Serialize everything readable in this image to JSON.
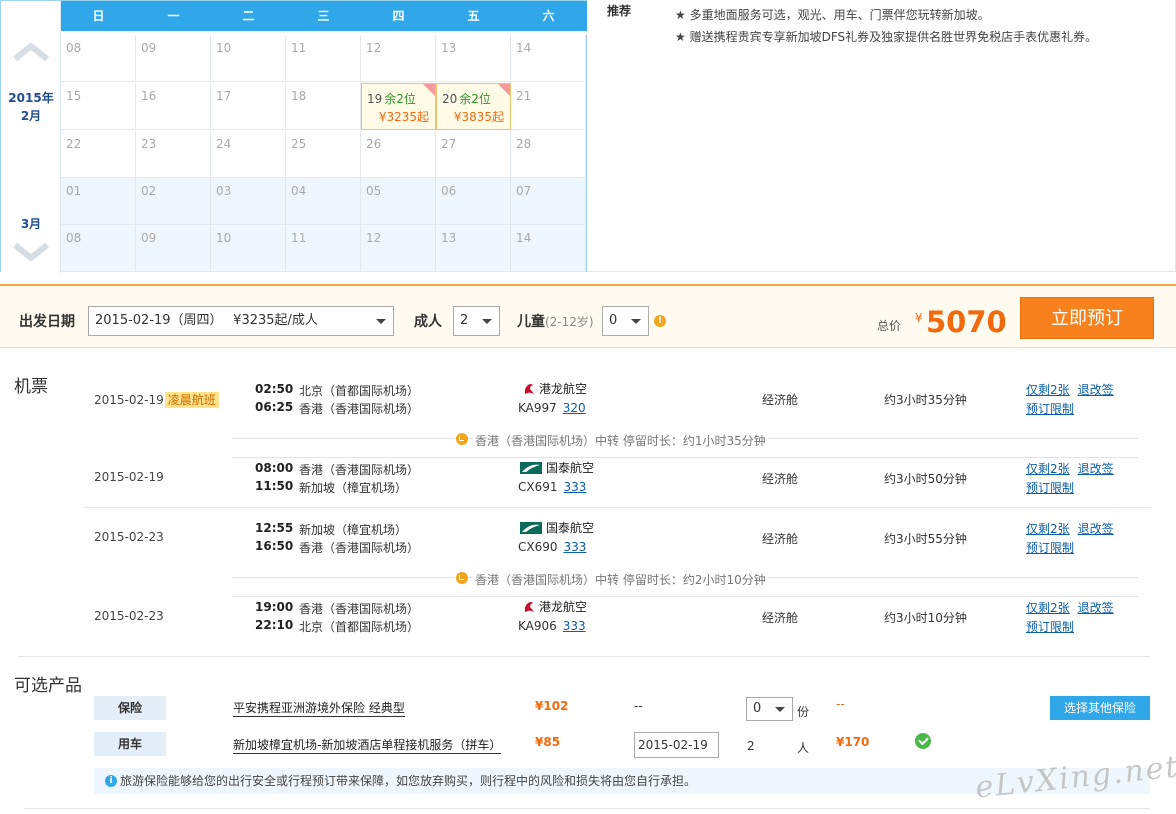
{
  "calendar": {
    "weekdays": [
      "日",
      "一",
      "二",
      "三",
      "四",
      "五",
      "六"
    ],
    "months": [
      {
        "label_year": "2015年",
        "label_month": "2月"
      },
      {
        "label_month": "3月"
      }
    ],
    "rows": [
      [
        "08",
        "09",
        "10",
        "11",
        "12",
        "13",
        "14"
      ],
      [
        "15",
        "16",
        "17",
        "18",
        "19",
        "20",
        "21"
      ],
      [
        "22",
        "23",
        "24",
        "25",
        "26",
        "27",
        "28"
      ],
      [
        "01",
        "02",
        "03",
        "04",
        "05",
        "06",
        "07"
      ],
      [
        "08",
        "09",
        "10",
        "11",
        "12",
        "13",
        "14"
      ]
    ],
    "highlights": [
      {
        "day": "19",
        "seats": "余2位",
        "price": "¥3235起"
      },
      {
        "day": "20",
        "seats": "余2位",
        "price": "¥3835起"
      }
    ]
  },
  "recommend": {
    "title": "推荐",
    "lines": [
      "★ 多重地面服务可选，观光、用车、门票伴您玩转新加坡。",
      "★ 赠送携程贵宾专享新加坡DFS礼券及独家提供名胜世界免税店手表优惠礼券。"
    ]
  },
  "order": {
    "date_label": "出发日期",
    "date_value": "2015-02-19（周四）　 ¥3235起/成人",
    "adult_label": "成人",
    "adult_value": "2",
    "child_label": "儿童",
    "child_age": "(2-12岁)",
    "child_value": "0",
    "total_label": "总价",
    "currency": "¥",
    "total": "5070",
    "book_label": "立即预订"
  },
  "flights": {
    "section_title": "机票",
    "legs": [
      {
        "date": "2015-02-19",
        "tag": "凌晨航班",
        "dep_time": "02:50",
        "dep_airport": "北京（首都国际机场）",
        "arr_time": "06:25",
        "arr_airport": "香港（香港国际机场）",
        "airline": "港龙航空",
        "flight_no": "KA997",
        "aircraft": "320",
        "cabin": "经济舱",
        "duration": "约3小时35分钟",
        "remain": "仅剩2张",
        "change": "退改签",
        "restrict": "预订限制"
      },
      {
        "date": "2015-02-19",
        "tag": "",
        "dep_time": "08:00",
        "dep_airport": "香港（香港国际机场）",
        "arr_time": "11:50",
        "arr_airport": "新加坡（樟宜机场）",
        "airline": "国泰航空",
        "flight_no": "CX691",
        "aircraft": "333",
        "cabin": "经济舱",
        "duration": "约3小时50分钟",
        "remain": "仅剩2张",
        "change": "退改签",
        "restrict": "预订限制"
      },
      {
        "date": "2015-02-23",
        "tag": "",
        "dep_time": "12:55",
        "dep_airport": "新加坡（樟宜机场）",
        "arr_time": "16:50",
        "arr_airport": "香港（香港国际机场）",
        "airline": "国泰航空",
        "flight_no": "CX690",
        "aircraft": "333",
        "cabin": "经济舱",
        "duration": "约3小时55分钟",
        "remain": "仅剩2张",
        "change": "退改签",
        "restrict": "预订限制"
      },
      {
        "date": "2015-02-23",
        "tag": "",
        "dep_time": "19:00",
        "dep_airport": "香港（香港国际机场）",
        "arr_time": "22:10",
        "arr_airport": "北京（首都国际机场）",
        "airline": "港龙航空",
        "flight_no": "KA906",
        "aircraft": "333",
        "cabin": "经济舱",
        "duration": "约3小时10分钟",
        "remain": "仅剩2张",
        "change": "退改签",
        "restrict": "预订限制"
      }
    ],
    "transfers": [
      "香港（香港国际机场）中转  停留时长：约1小时35分钟",
      "香港（香港国际机场）中转  停留时长：约2小时10分钟"
    ]
  },
  "products": {
    "section_title": "可选产品",
    "insurance": {
      "label": "保险",
      "name": "平安携程亚洲游境外保险 经典型",
      "price": "¥102",
      "dash": "--",
      "qty": "0",
      "unit": "份",
      "subtotal": "--",
      "other_button": "选择其他保险"
    },
    "car": {
      "label": "用车",
      "name": "新加坡樟宜机场-新加坡酒店单程接机服务（拼车）",
      "price": "¥85",
      "date": "2015-02-19",
      "qty": "2",
      "unit": "人",
      "subtotal": "¥170"
    },
    "notice": "旅游保险能够给您的出行安全或行程预订带来保障，如您放弃购买，则行程中的风险和损失将由您自行承担。"
  },
  "watermark": "eLvXing.net",
  "colors": {
    "accent": "#2fa7e8",
    "orange": "#f26a0e",
    "button": "#f7811d"
  }
}
